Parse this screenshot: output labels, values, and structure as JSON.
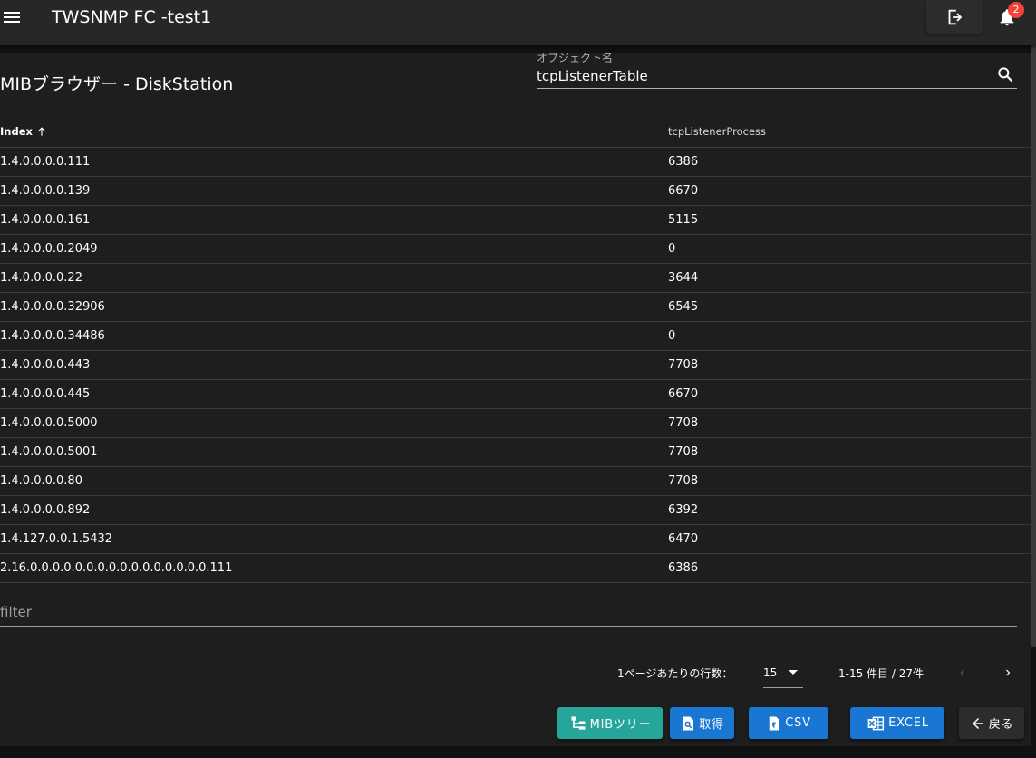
{
  "app": {
    "title": "TWSNMP FC -test1",
    "notification_count": "2"
  },
  "page": {
    "title": "MIBブラウザー - DiskStation",
    "object_name_label": "オブジェクト名",
    "object_name_value": "tcpListenerTable"
  },
  "table": {
    "headers": [
      "Index",
      "tcpListenerProcess"
    ],
    "sort": {
      "column": "Index",
      "direction": "ascending"
    },
    "rows": [
      [
        "1.4.0.0.0.0.111",
        "6386"
      ],
      [
        "1.4.0.0.0.0.139",
        "6670"
      ],
      [
        "1.4.0.0.0.0.161",
        "5115"
      ],
      [
        "1.4.0.0.0.0.2049",
        "0"
      ],
      [
        "1.4.0.0.0.0.22",
        "3644"
      ],
      [
        "1.4.0.0.0.0.32906",
        "6545"
      ],
      [
        "1.4.0.0.0.0.34486",
        "0"
      ],
      [
        "1.4.0.0.0.0.443",
        "7708"
      ],
      [
        "1.4.0.0.0.0.445",
        "6670"
      ],
      [
        "1.4.0.0.0.0.5000",
        "7708"
      ],
      [
        "1.4.0.0.0.0.5001",
        "7708"
      ],
      [
        "1.4.0.0.0.0.80",
        "7708"
      ],
      [
        "1.4.0.0.0.0.892",
        "6392"
      ],
      [
        "1.4.127.0.0.1.5432",
        "6470"
      ],
      [
        "2.16.0.0.0.0.0.0.0.0.0.0.0.0.0.0.0.0.111",
        "6386"
      ]
    ],
    "filter_placeholder": "filter"
  },
  "pagination": {
    "rows_per_page_label": "1ページあたりの行数：",
    "rows_per_page_value": "15",
    "range_text": "1-15 件目 / 27件"
  },
  "buttons": {
    "mib_tree": "MIBツリー",
    "get": "取得",
    "csv": "CSV",
    "excel": "EXCEL",
    "back": "戻る"
  },
  "icons": [
    "menu-icon",
    "logout-icon",
    "bell-icon",
    "search-icon",
    "arrow-up-icon",
    "chevron-left-icon",
    "chevron-right-icon",
    "file-tree-icon",
    "file-search-icon",
    "file-csv-icon",
    "file-excel-icon",
    "arrow-left-icon"
  ],
  "colors": {
    "teal": "#26a69a",
    "blue": "#1976d2",
    "badge": "#f44336",
    "background": "#121212",
    "surface": "#1e1e1e"
  }
}
